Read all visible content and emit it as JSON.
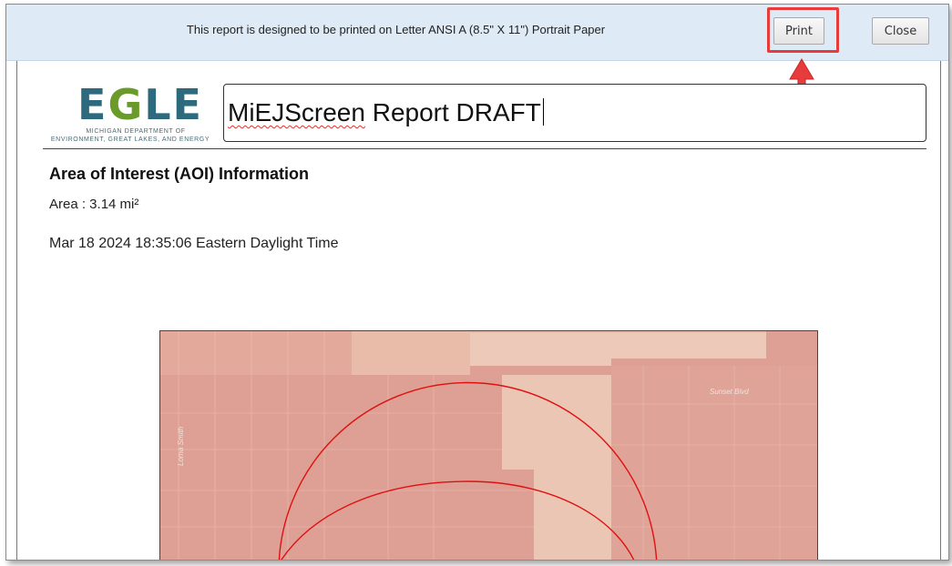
{
  "topbar": {
    "message": "This report is designed to be printed on Letter ANSI A (8.5\" X 11\") Portrait Paper",
    "print_label": "Print",
    "close_label": "Close"
  },
  "logo": {
    "wordmark_e1": "E",
    "wordmark_g": "G",
    "wordmark_le": "LE",
    "line1": "MICHIGAN DEPARTMENT OF",
    "line2": "ENVIRONMENT, GREAT LAKES, AND ENERGY"
  },
  "report": {
    "title_misspelled": "MiEJScreen",
    "title_rest": " Report DRAFT",
    "aoi_heading": "Area of Interest (AOI) Information",
    "area": "Area : 3.14 mi²",
    "timestamp": "Mar 18 2024 18:35:06 Eastern Daylight Time"
  },
  "map": {
    "street_label_1": "Sunset Blvd",
    "street_label_2": "Lorna Smith",
    "aoi_outline_color": "#e01010"
  },
  "annotation": {
    "highlight_color": "#e63c3c"
  }
}
